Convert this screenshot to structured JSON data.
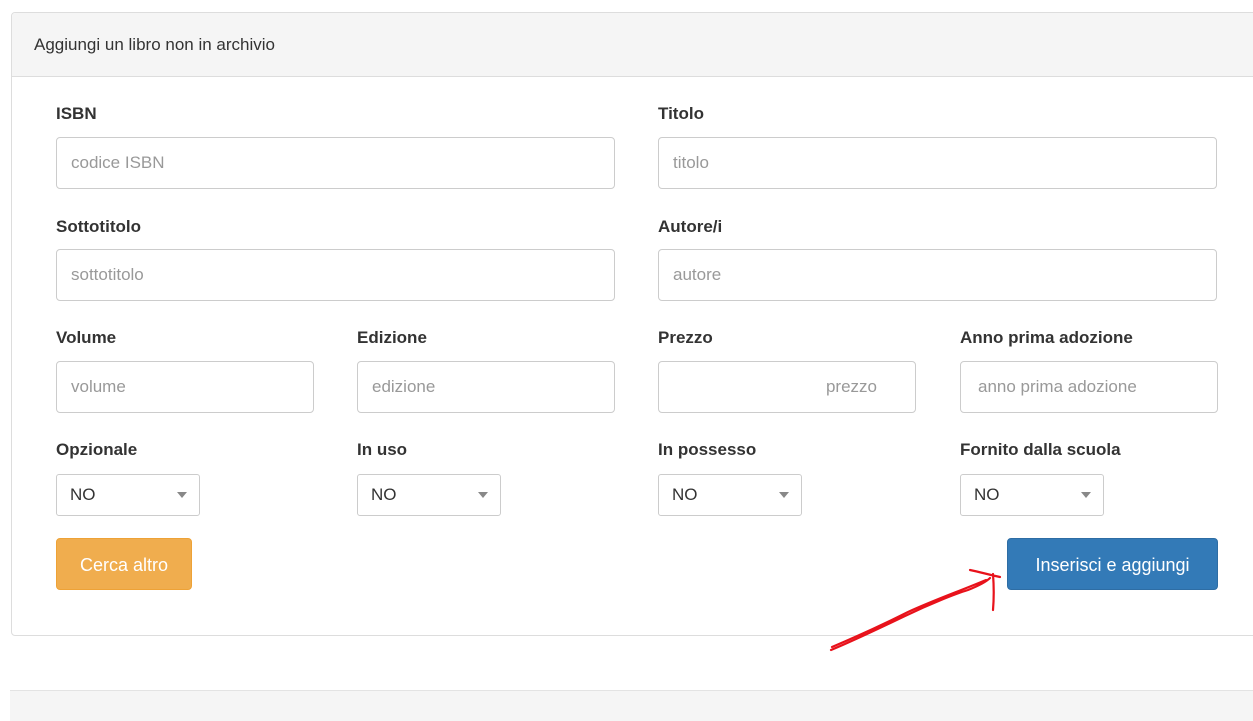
{
  "panel": {
    "title": "Aggiungi un libro non in archivio"
  },
  "fields": {
    "isbn": {
      "label": "ISBN",
      "placeholder": "codice ISBN"
    },
    "titolo": {
      "label": "Titolo",
      "placeholder": "titolo"
    },
    "sottotitolo": {
      "label": "Sottotitolo",
      "placeholder": "sottotitolo"
    },
    "autore": {
      "label": "Autore/i",
      "placeholder": "autore"
    },
    "volume": {
      "label": "Volume",
      "placeholder": "volume"
    },
    "edizione": {
      "label": "Edizione",
      "placeholder": "edizione"
    },
    "prezzo": {
      "label": "Prezzo",
      "placeholder": "prezzo"
    },
    "anno": {
      "label": "Anno prima adozione",
      "placeholder": "anno prima adozione"
    }
  },
  "selects": {
    "opzionale": {
      "label": "Opzionale",
      "value": "NO"
    },
    "in_uso": {
      "label": "In uso",
      "value": "NO"
    },
    "in_possesso": {
      "label": "In possesso",
      "value": "NO"
    },
    "fornito": {
      "label": "Fornito dalla scuola",
      "value": "NO"
    }
  },
  "buttons": {
    "cerca_altro": "Cerca altro",
    "inserisci": "Inserisci e aggiungi"
  },
  "colors": {
    "warning": "#f0ad4e",
    "primary": "#337ab7",
    "annotation": "#e8121b"
  }
}
